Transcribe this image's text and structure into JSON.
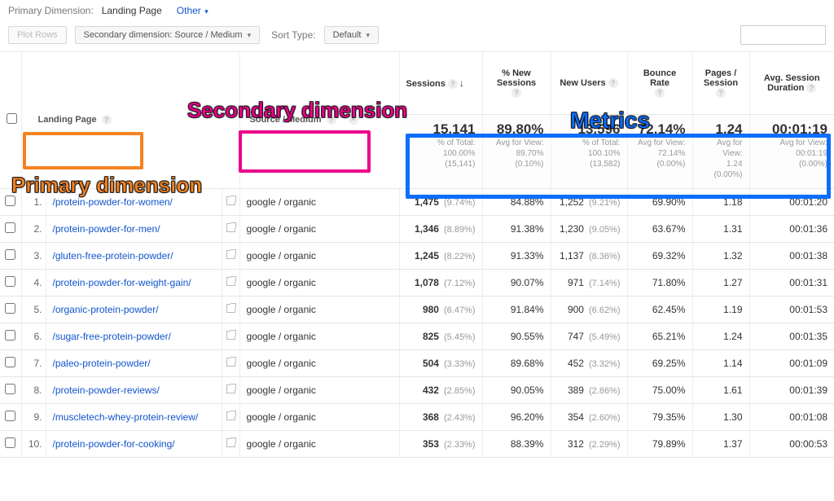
{
  "topbar": {
    "label": "Primary Dimension:",
    "primary_dim": "Landing Page",
    "other": "Other"
  },
  "controls": {
    "plot_rows": "Plot Rows",
    "secondary_dim": "Secondary dimension: Source / Medium",
    "sort_type_label": "Sort Type:",
    "sort_type_value": "Default"
  },
  "headers": {
    "landing_page": "Landing Page",
    "source_medium": "Source / Medium",
    "sessions": "Sessions",
    "pct_new_sessions": "% New Sessions",
    "new_users": "New Users",
    "bounce_rate": "Bounce Rate",
    "pages_session": "Pages / Session",
    "avg_session_duration": "Avg. Session Duration"
  },
  "summary": {
    "sessions": {
      "big": "15,141",
      "l1": "% of Total:",
      "l2": "100.00%",
      "l3": "(15,141)"
    },
    "pct_new": {
      "big": "89.80%",
      "l1": "Avg for View:",
      "l2": "89.70%",
      "l3": "(0.10%)"
    },
    "new_users": {
      "big": "13,596",
      "l1": "% of Total:",
      "l2": "100.10%",
      "l3": "(13,582)"
    },
    "bounce": {
      "big": "72.14%",
      "l1": "Avg for View:",
      "l2": "72.14%",
      "l3": "(0.00%)"
    },
    "pages": {
      "big": "1.24",
      "l1": "Avg for",
      "l2": "View:",
      "l3": "1.24",
      "l4": "(0.00%)"
    },
    "duration": {
      "big": "00:01:19",
      "l1": "Avg for View:",
      "l2": "00:01:19",
      "l3": "(0.00%)"
    }
  },
  "rows": [
    {
      "idx": "1.",
      "page": "/protein-powder-for-women/",
      "source": "google / organic",
      "sessions": "1,475",
      "sess_pct": "(9.74%)",
      "pct_new": "84.88%",
      "new_users": "1,252",
      "nu_pct": "(9.21%)",
      "bounce": "69.90%",
      "pages": "1.18",
      "dur": "00:01:20"
    },
    {
      "idx": "2.",
      "page": "/protein-powder-for-men/",
      "source": "google / organic",
      "sessions": "1,346",
      "sess_pct": "(8.89%)",
      "pct_new": "91.38%",
      "new_users": "1,230",
      "nu_pct": "(9.05%)",
      "bounce": "63.67%",
      "pages": "1.31",
      "dur": "00:01:36"
    },
    {
      "idx": "3.",
      "page": "/gluten-free-protein-powder/",
      "source": "google / organic",
      "sessions": "1,245",
      "sess_pct": "(8.22%)",
      "pct_new": "91.33%",
      "new_users": "1,137",
      "nu_pct": "(8.36%)",
      "bounce": "69.32%",
      "pages": "1.32",
      "dur": "00:01:38"
    },
    {
      "idx": "4.",
      "page": "/protein-powder-for-weight-gain/",
      "source": "google / organic",
      "sessions": "1,078",
      "sess_pct": "(7.12%)",
      "pct_new": "90.07%",
      "new_users": "971",
      "nu_pct": "(7.14%)",
      "bounce": "71.80%",
      "pages": "1.27",
      "dur": "00:01:31"
    },
    {
      "idx": "5.",
      "page": "/organic-protein-powder/",
      "source": "google / organic",
      "sessions": "980",
      "sess_pct": "(6.47%)",
      "pct_new": "91.84%",
      "new_users": "900",
      "nu_pct": "(6.62%)",
      "bounce": "62.45%",
      "pages": "1.19",
      "dur": "00:01:53"
    },
    {
      "idx": "6.",
      "page": "/sugar-free-protein-powder/",
      "source": "google / organic",
      "sessions": "825",
      "sess_pct": "(5.45%)",
      "pct_new": "90.55%",
      "new_users": "747",
      "nu_pct": "(5.49%)",
      "bounce": "65.21%",
      "pages": "1.24",
      "dur": "00:01:35"
    },
    {
      "idx": "7.",
      "page": "/paleo-protein-powder/",
      "source": "google / organic",
      "sessions": "504",
      "sess_pct": "(3.33%)",
      "pct_new": "89.68%",
      "new_users": "452",
      "nu_pct": "(3.32%)",
      "bounce": "69.25%",
      "pages": "1.14",
      "dur": "00:01:09"
    },
    {
      "idx": "8.",
      "page": "/protein-powder-reviews/",
      "source": "google / organic",
      "sessions": "432",
      "sess_pct": "(2.85%)",
      "pct_new": "90.05%",
      "new_users": "389",
      "nu_pct": "(2.86%)",
      "bounce": "75.00%",
      "pages": "1.61",
      "dur": "00:01:39"
    },
    {
      "idx": "9.",
      "page": "/muscletech-whey-protein-review/",
      "source": "google / organic",
      "sessions": "368",
      "sess_pct": "(2.43%)",
      "pct_new": "96.20%",
      "new_users": "354",
      "nu_pct": "(2.60%)",
      "bounce": "79.35%",
      "pages": "1.30",
      "dur": "00:01:08"
    },
    {
      "idx": "10.",
      "page": "/protein-powder-for-cooking/",
      "source": "google / organic",
      "sessions": "353",
      "sess_pct": "(2.33%)",
      "pct_new": "88.39%",
      "new_users": "312",
      "nu_pct": "(2.29%)",
      "bounce": "79.89%",
      "pages": "1.37",
      "dur": "00:00:53"
    }
  ],
  "annotations": {
    "primary": "Primary dimension",
    "secondary": "Secondary dimension",
    "metrics": "Metrics"
  }
}
